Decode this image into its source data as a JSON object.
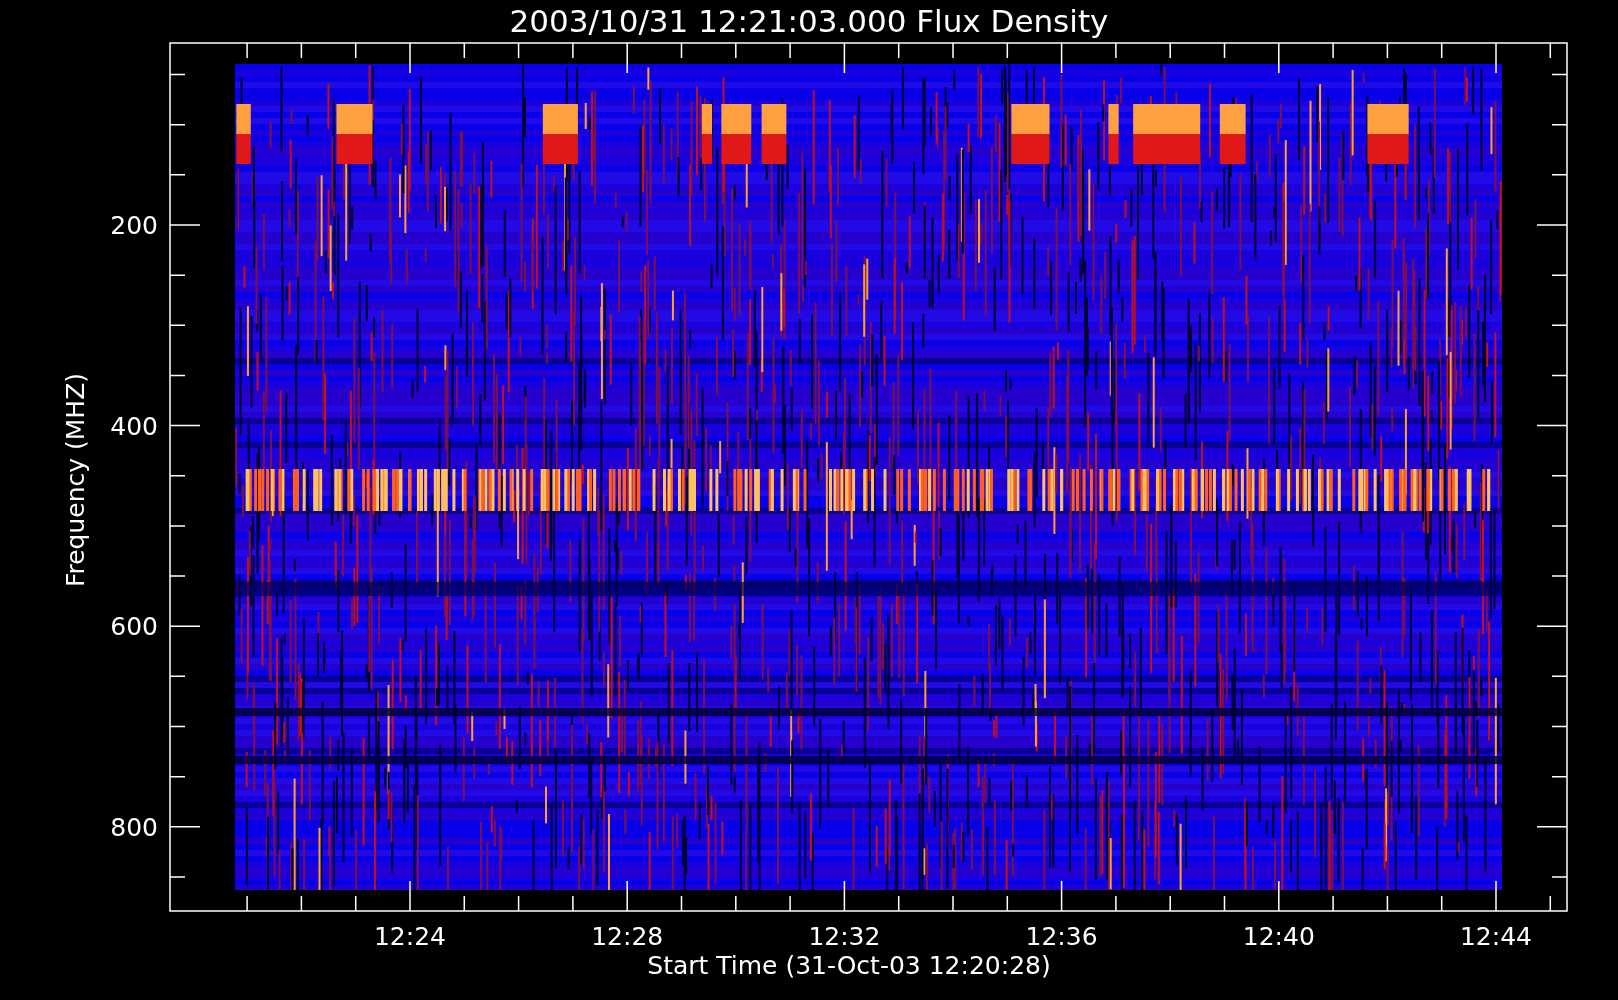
{
  "plot": {
    "title": "2003/10/31 12:21:03.000 Flux Density",
    "xlabel": "Start Time (31-Oct-03 12:20:28)",
    "ylabel": "Frequency (MHZ)",
    "xticks": [
      "12:24",
      "12:28",
      "12:32",
      "12:36",
      "12:40",
      "12:44"
    ],
    "yticks": [
      "200",
      "400",
      "600",
      "800"
    ]
  }
}
